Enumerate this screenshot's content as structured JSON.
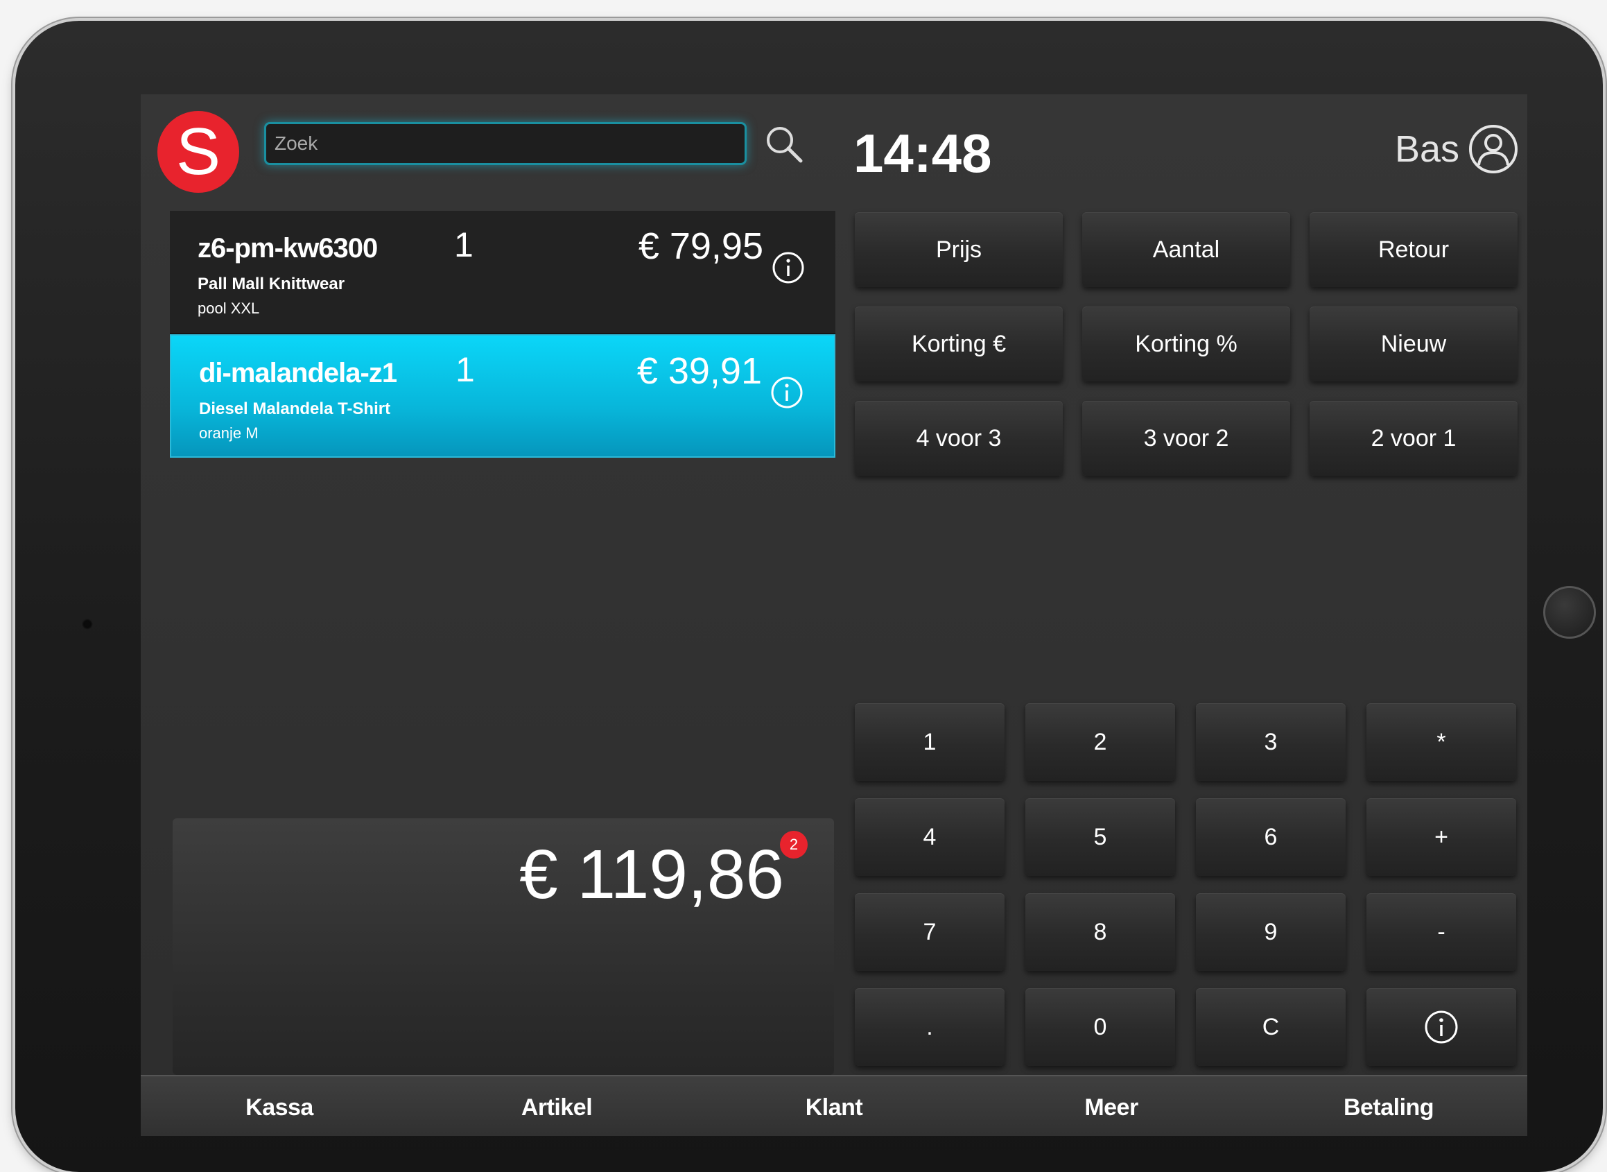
{
  "header": {
    "logo_letter": "S",
    "search_placeholder": "Zoek",
    "clock": "14:48",
    "user_name": "Bas"
  },
  "receipt": [
    {
      "code": "z6-pm-kw6300",
      "quantity": "1",
      "price": "€ 79,95",
      "description": "Pall Mall Knittwear",
      "variant": "pool XXL",
      "selected": false
    },
    {
      "code": "di-malandela-z1",
      "quantity": "1",
      "price": "€ 39,91",
      "description": "Diesel Malandela T-Shirt",
      "variant": "oranje M",
      "selected": true
    }
  ],
  "total": {
    "amount": "€ 119,86",
    "item_count": "2"
  },
  "function_buttons": [
    "Prijs",
    "Aantal",
    "Retour",
    "Korting €",
    "Korting %",
    "Nieuw",
    "4 voor 3",
    "3 voor 2",
    "2 voor 1"
  ],
  "keypad": [
    "1",
    "2",
    "3",
    "*",
    "4",
    "5",
    "6",
    "+",
    "7",
    "8",
    "9",
    "-",
    ".",
    "0",
    "C",
    "info-icon"
  ],
  "nav": [
    "Kassa",
    "Artikel",
    "Klant",
    "Meer",
    "Betaling"
  ],
  "colors": {
    "brand_red": "#e8232d",
    "selected_row": "#08c4e8",
    "search_glow": "#1a8fa0"
  }
}
